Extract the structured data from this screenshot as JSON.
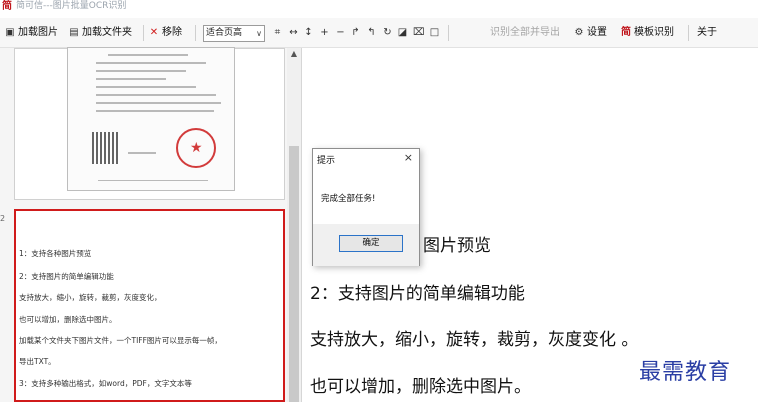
{
  "window": {
    "app_icon": "简",
    "title": "简可信---图片批量OCR识别"
  },
  "toolbar": {
    "load_image": "加载图片",
    "load_folder": "加载文件夹",
    "remove": "移除",
    "fit_mode": "适合页高",
    "recognize_export": "识别全部并导出",
    "settings": "设置",
    "template_recognize": "模板识别",
    "about": "关于",
    "icons": [
      "load-image-icon",
      "load-folder-icon",
      "remove-icon",
      "fit-mode-chevron-down-icon",
      "fit-window-icon",
      "fit-width-icon",
      "fit-height-icon",
      "zoom-in-icon",
      "zoom-out-icon",
      "rotate-right-icon",
      "rotate-left-icon",
      "rotate-icon",
      "grayscale-icon",
      "crop-icon",
      "select-box-icon",
      "settings-gear-icon",
      "template-icon"
    ]
  },
  "thumbnails": {
    "row_marker": "2",
    "second_lines": [
      "1：支持各种图片预览",
      "2：支持图片的简单编辑功能",
      "支持放大，缩小，旋转，裁剪，灰度变化，",
      "也可以增加，删除选中图片。",
      "加载某个文件夹下图片文件，一个TIFF图片可以显示每一帧，",
      "导出TXT。",
      "3：支持多种输出格式，如word，PDF，文字文本等"
    ]
  },
  "preview": {
    "lines": [
      "图片预览",
      "2：支持图片的简单编辑功能",
      "支持放大，缩小，旋转，裁剪，灰度变化 。",
      "也可以增加，删除选中图片。"
    ]
  },
  "dialog": {
    "title": "提示",
    "close": "×",
    "message": "完成全部任务!",
    "ok_button": "确定"
  },
  "watermark": "最需教育",
  "colors": {
    "accent_red": "#d01b1b",
    "dialog_button_border": "#2b73c8",
    "watermark_blue": "#2a3ea4"
  }
}
